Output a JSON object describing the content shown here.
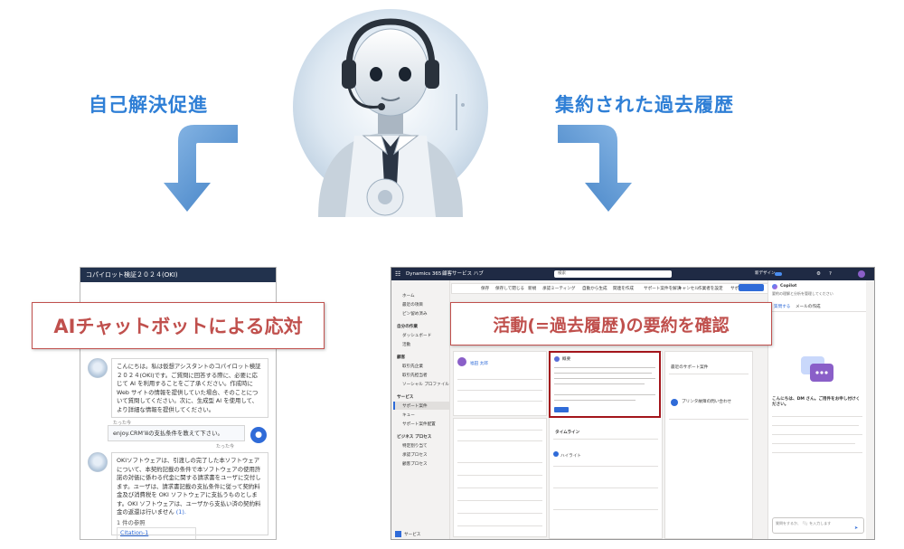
{
  "headings": {
    "left": "自己解決促進",
    "right": "集約された過去履歴"
  },
  "colors": {
    "heading": "#2f7fd6",
    "arrow": "#5b9bd5",
    "callout_border": "#c0504d",
    "callout_text": "#c0504d"
  },
  "callouts": {
    "chatbot": "AIチャットボットによる応対",
    "history": "活動(=過去履歴)の要約を確認"
  },
  "chat": {
    "title": "コパイロット検証２０２４(OKI)",
    "message1": "こんにちは。私は仮想アシスタントのコパイロット検証２０２４(OKI)です。ご質問に回答する際に、必要に応じて AI を利用することをご了承ください。作成時に Web サイトの情報を提供していた場合、そのことについて質問してください。次に、生成型 AI を使用して、より詳細な情報を提供してください。",
    "time1": "たった今",
    "user_message": "enjoy.CRM’ⅲの支払条件を教えて下さい。",
    "time2": "たった今",
    "message2": "OKIソフトウェアは、引渡しの完了した本ソフトウェアについて、本契約記載の条件で本ソフトウェアの使用許諾の対価に係わる代金に関する請求書をユーザに交付します。ユーザは、請求書記載の支払条件に従って契約料金及び消費税を OKI ソフトウェアに支払うものとします。OKI ソフトウェアは、ユーザから支払い済の契約料金の返還は行いません",
    "citation_ref": "(1).",
    "references_label": "1 件の参照",
    "citation": "Citation-1"
  },
  "dynamics": {
    "app_name": "Dynamics 365",
    "app_area": "顧客サービス ハブ",
    "search_placeholder": "検索",
    "new_design": "新デザイン",
    "nav_items": [
      "ホーム",
      "最近の項目",
      "ピン留め済み",
      "自分の作業",
      "ダッシュボード",
      "活動",
      "顧客",
      "取引先企業",
      "取引先担当者",
      "ソーシャル プロファイル",
      "サービス",
      "サポート案件",
      "キュー",
      "サポート案件配置",
      "ビジネス プロセス",
      "特定割り当て",
      "承認プロセス",
      "顧客プロセス"
    ],
    "nav_footer": "サービス",
    "toolbar": [
      "保存",
      "保存して閉じる",
      "新規",
      "承認ミーティング",
      "自動から生成",
      "関連を作成",
      "サポート案件を解決",
      "キャンセル",
      "作業者を設定",
      "サポート案件の..."
    ],
    "copilot_title": "Copilot",
    "copilot_sub": "要約の理解と分析を管理してください",
    "copilot_tabs": [
      "質問する",
      "メールの作成"
    ],
    "copilot_greeting": "こんにちは、DM さん。ご用件をお申し付けください。",
    "copilot_summary_title": "概要",
    "timeline_label": "タイムライン",
    "activity_label": "ハイライト",
    "related_title": "最近のサポート案件",
    "related_item": "プリンタ故障の問い合わせ",
    "input_placeholder": "質問をするか、「/」を入力します",
    "record_name": "福田 太郎"
  }
}
